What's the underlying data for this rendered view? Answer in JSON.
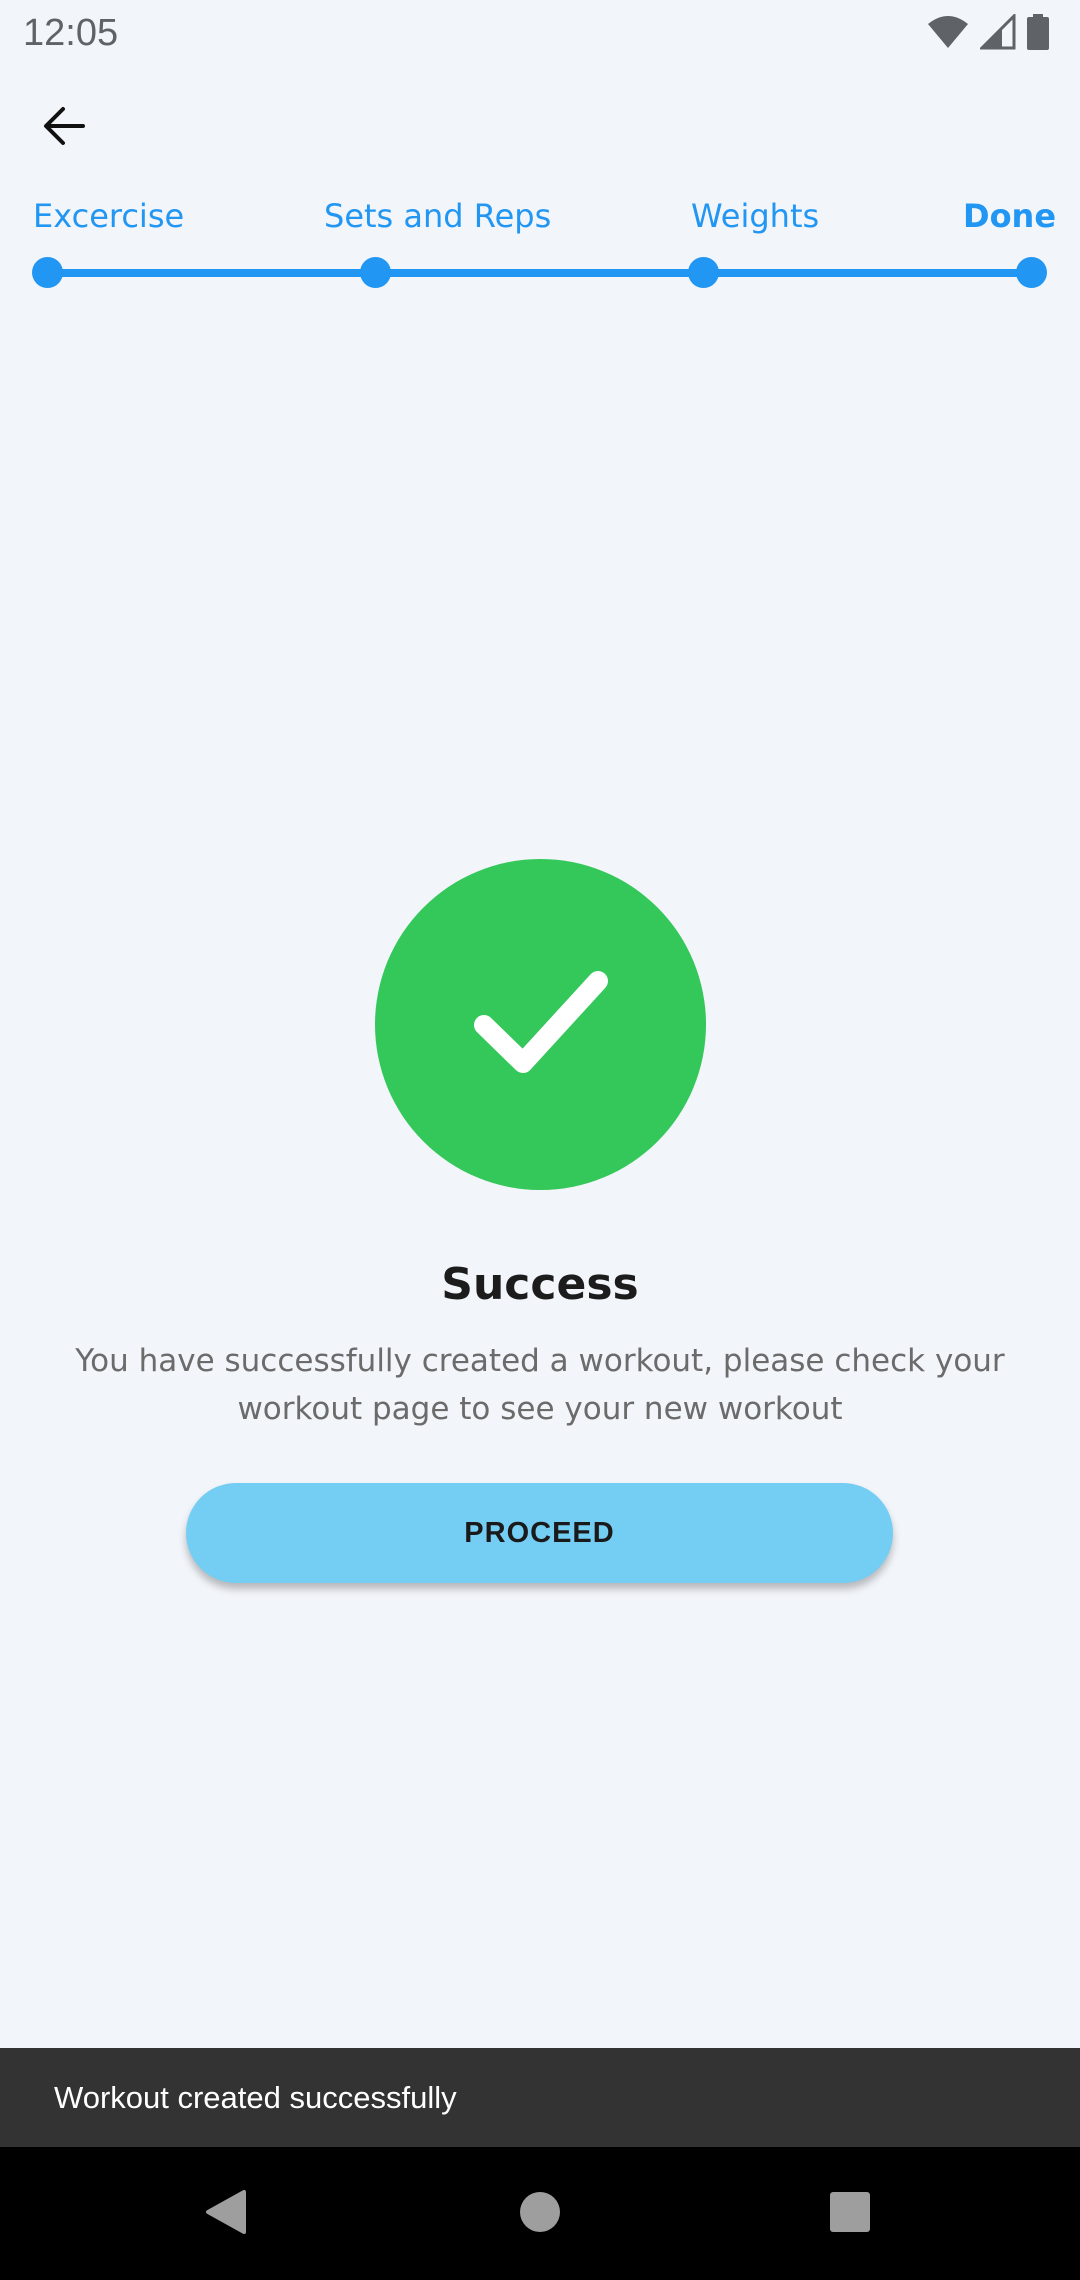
{
  "status_bar": {
    "time": "12:05",
    "icons": [
      "wifi-icon",
      "signal-icon",
      "battery-icon"
    ]
  },
  "header": {
    "back_icon": "arrow-left-icon"
  },
  "stepper": {
    "steps": [
      {
        "label": "Excercise",
        "active": false
      },
      {
        "label": "Sets and Reps",
        "active": false
      },
      {
        "label": "Weights",
        "active": false
      },
      {
        "label": "Done",
        "active": true
      }
    ],
    "color": "#2196f3"
  },
  "success": {
    "icon": "check-icon",
    "color": "#34c759",
    "title": "Success",
    "message": "You have successfully created a workout, please check your workout page to see your new workout"
  },
  "proceed_button": {
    "label": "PROCEED",
    "color": "#74cdf3"
  },
  "snackbar": {
    "text": "Workout created successfully"
  },
  "nav_bar": {
    "buttons": [
      "back-triangle-icon",
      "home-circle-icon",
      "recents-square-icon"
    ]
  }
}
